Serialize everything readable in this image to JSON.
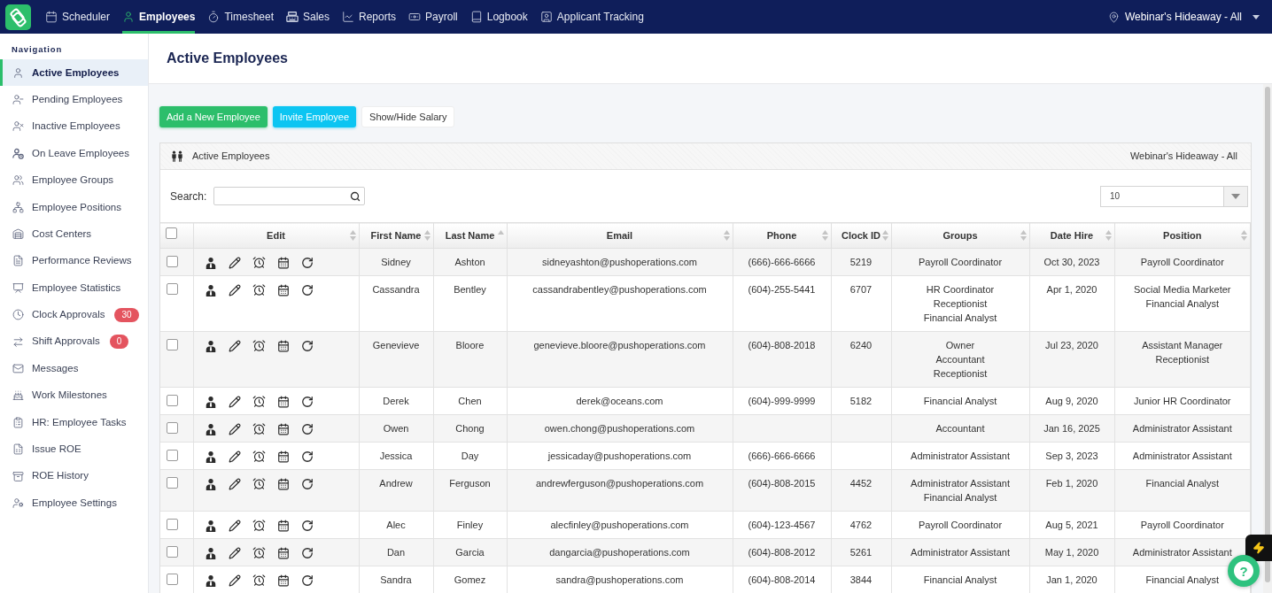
{
  "top_nav": {
    "items": [
      {
        "label": "Scheduler",
        "selected": false
      },
      {
        "label": "Employees",
        "selected": true
      },
      {
        "label": "Timesheet",
        "selected": false
      },
      {
        "label": "Sales",
        "selected": false
      },
      {
        "label": "Reports",
        "selected": false
      },
      {
        "label": "Payroll",
        "selected": false
      },
      {
        "label": "Logbook",
        "selected": false
      },
      {
        "label": "Applicant Tracking",
        "selected": false
      }
    ],
    "location": "Webinar's Hideaway - All"
  },
  "sidebar": {
    "heading": "Navigation",
    "items": [
      {
        "label": "Active Employees",
        "selected": true
      },
      {
        "label": "Pending Employees",
        "selected": false
      },
      {
        "label": "Inactive Employees",
        "selected": false
      },
      {
        "label": "On Leave Employees",
        "selected": false
      },
      {
        "label": "Employee Groups",
        "selected": false
      },
      {
        "label": "Employee Positions",
        "selected": false
      },
      {
        "label": "Cost Centers",
        "selected": false
      },
      {
        "label": "Performance Reviews",
        "selected": false
      },
      {
        "label": "Employee Statistics",
        "selected": false
      },
      {
        "label": "Clock Approvals",
        "selected": false,
        "badge": "30"
      },
      {
        "label": "Shift Approvals",
        "selected": false,
        "badge": "0"
      },
      {
        "label": "Messages",
        "selected": false
      },
      {
        "label": "Work Milestones",
        "selected": false
      },
      {
        "label": "HR: Employee Tasks",
        "selected": false
      },
      {
        "label": "Issue ROE",
        "selected": false
      },
      {
        "label": "ROE History",
        "selected": false
      },
      {
        "label": "Employee Settings",
        "selected": false
      }
    ]
  },
  "page_title": "Active Employees",
  "actions": [
    {
      "label": "Add a New Employee",
      "kind": "primary"
    },
    {
      "label": "Invite Employee",
      "kind": "info"
    },
    {
      "label": "Show/Hide Salary",
      "kind": "plain"
    }
  ],
  "panel": {
    "title": "Active Employees",
    "location": "Webinar's Hideaway - All"
  },
  "search": {
    "label": "Search:"
  },
  "page_size": {
    "value": "10"
  },
  "table": {
    "select_all": {
      "checked": false
    },
    "columns": [
      {
        "label": "Edit",
        "sorted": false
      },
      {
        "label": "First Name",
        "sorted": false
      },
      {
        "label": "Last Name",
        "sorted": true
      },
      {
        "label": "Email",
        "sorted": false
      },
      {
        "label": "Phone",
        "sorted": false
      },
      {
        "label": "Clock ID",
        "sorted": false
      },
      {
        "label": "Groups",
        "sorted": false
      },
      {
        "label": "Date Hire",
        "sorted": false
      },
      {
        "label": "Position",
        "sorted": false
      }
    ],
    "rows": [
      {
        "checked": false,
        "first_name": "Sidney",
        "last_name": "Ashton",
        "email": "sidneyashton@pushoperations.com",
        "phone": "(666)-666-6666",
        "clock_id": "5219",
        "groups": [
          "Payroll Coordinator"
        ],
        "date_hire": "Oct 30, 2023",
        "position": [
          "Payroll Coordinator"
        ]
      },
      {
        "checked": false,
        "first_name": "Cassandra",
        "last_name": "Bentley",
        "email": "cassandrabentley@pushoperations.com",
        "phone": "(604)-255-5441",
        "clock_id": "6707",
        "groups": [
          "HR Coordinator",
          "Receptionist",
          "Financial Analyst"
        ],
        "date_hire": "Apr 1, 2020",
        "position": [
          "Social Media Marketer",
          "Financial Analyst"
        ]
      },
      {
        "checked": false,
        "first_name": "Genevieve",
        "last_name": "Bloore",
        "email": "genevieve.bloore@pushoperations.com",
        "phone": "(604)-808-2018",
        "clock_id": "6240",
        "groups": [
          "Owner",
          "Accountant",
          "Receptionist"
        ],
        "date_hire": "Jul 23, 2020",
        "position": [
          "Assistant Manager",
          "Receptionist"
        ]
      },
      {
        "checked": false,
        "first_name": "Derek",
        "last_name": "Chen",
        "email": "derek@oceans.com",
        "phone": "(604)-999-9999",
        "clock_id": "5182",
        "groups": [
          "Financial Analyst"
        ],
        "date_hire": "Aug 9, 2020",
        "position": [
          "Junior HR Coordinator"
        ]
      },
      {
        "checked": false,
        "first_name": "Owen",
        "last_name": "Chong",
        "email": "owen.chong@pushoperations.com",
        "groups": [
          "Accountant"
        ],
        "date_hire": "Jan 16, 2025",
        "position": [
          "Administrator Assistant"
        ]
      },
      {
        "checked": false,
        "first_name": "Jessica",
        "last_name": "Day",
        "email": "jessicaday@pushoperations.com",
        "phone": "(666)-666-6666",
        "groups": [
          "Administrator Assistant"
        ],
        "date_hire": "Sep 3, 2023",
        "position": [
          "Administrator Assistant"
        ]
      },
      {
        "checked": false,
        "first_name": "Andrew",
        "last_name": "Ferguson",
        "email": "andrewferguson@pushoperations.com",
        "phone": "(604)-808-2015",
        "clock_id": "4452",
        "groups": [
          "Administrator Assistant",
          "Financial Analyst"
        ],
        "date_hire": "Feb 1, 2020",
        "position": [
          "Financial Analyst"
        ]
      },
      {
        "checked": false,
        "first_name": "Alec",
        "last_name": "Finley",
        "email": "alecfinley@pushoperations.com",
        "phone": "(604)-123-4567",
        "clock_id": "4762",
        "groups": [
          "Payroll Coordinator"
        ],
        "date_hire": "Aug 5, 2021",
        "position": [
          "Payroll Coordinator"
        ]
      },
      {
        "checked": false,
        "first_name": "Dan",
        "last_name": "Garcia",
        "email": "dangarcia@pushoperations.com",
        "phone": "(604)-808-2012",
        "clock_id": "5261",
        "groups": [
          "Administrator Assistant"
        ],
        "date_hire": "May 1, 2020",
        "position": [
          "Administrator Assistant"
        ]
      },
      {
        "checked": false,
        "first_name": "Sandra",
        "last_name": "Gomez",
        "email": "sandra@pushoperations.com",
        "phone": "(604)-808-2014",
        "clock_id": "3844",
        "groups": [
          "Financial Analyst"
        ],
        "date_hire": "Jan 1, 2020",
        "position": [
          "Financial Analyst"
        ]
      }
    ]
  },
  "help_button": {
    "label": "?"
  }
}
